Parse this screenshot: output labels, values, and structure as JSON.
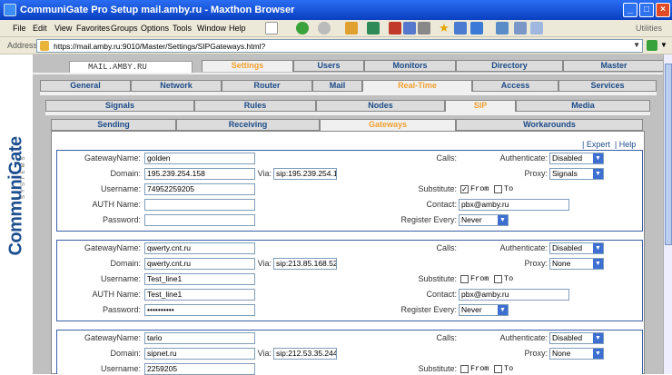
{
  "window": {
    "title": "CommuniGate Pro Setup mail.amby.ru - Maxthon Browser"
  },
  "menu": [
    "File",
    "Edit",
    "View",
    "Favorites",
    "Groups",
    "Options",
    "Tools",
    "Window",
    "Help"
  ],
  "utilities_label": "Utilities",
  "address": {
    "label": "Address",
    "url": "https://mail.amby.ru:9010/Master/Settings/SIPGateways.html?"
  },
  "logo": {
    "name": "CommuniGate",
    "sub": "SYSTEMS"
  },
  "server_name": "MAIL.AMBY.RU",
  "tabs_top": [
    {
      "label": "Settings",
      "selected": true
    },
    {
      "label": "Users",
      "selected": false
    },
    {
      "label": "Monitors",
      "selected": false
    },
    {
      "label": "Directory",
      "selected": false
    },
    {
      "label": "Master",
      "selected": false
    }
  ],
  "tabs_settings": [
    {
      "label": "General",
      "selected": false
    },
    {
      "label": "Network",
      "selected": false
    },
    {
      "label": "Router",
      "selected": false
    },
    {
      "label": "Mail",
      "selected": false
    },
    {
      "label": "Real-Time",
      "selected": true
    },
    {
      "label": "Access",
      "selected": false
    },
    {
      "label": "Services",
      "selected": false
    }
  ],
  "tabs_realtime": [
    {
      "label": "Signals",
      "selected": false
    },
    {
      "label": "Rules",
      "selected": false
    },
    {
      "label": "Nodes",
      "selected": false
    },
    {
      "label": "SIP",
      "selected": true
    },
    {
      "label": "Media",
      "selected": false
    }
  ],
  "tabs_sip": [
    {
      "label": "Sending",
      "selected": false
    },
    {
      "label": "Receiving",
      "selected": false
    },
    {
      "label": "Gateways",
      "selected": true
    },
    {
      "label": "Workarounds",
      "selected": false
    }
  ],
  "links": {
    "expert": "Expert",
    "help": "Help"
  },
  "labels": {
    "gateway_name": "GatewayName:",
    "domain": "Domain:",
    "username": "Username:",
    "auth_name": "AUTH Name:",
    "password": "Password:",
    "via": "Via:",
    "calls": "Calls:",
    "authenticate": "Authenticate:",
    "proxy": "Proxy:",
    "substitute": "Substitute:",
    "from": "From",
    "to": "To",
    "contact": "Contact:",
    "register_every": "Register Every:"
  },
  "gateways": [
    {
      "name": "golden",
      "domain": "195.239.254.158",
      "via": "sip:195.239.254.1",
      "username": "74952259205",
      "auth_name": "",
      "password": "",
      "authenticate": "Disabled",
      "proxy": "Signals",
      "sub_from": true,
      "sub_to": false,
      "contact": "pbx@amby.ru",
      "register_every": "Never"
    },
    {
      "name": "qwerty.cnt.ru",
      "domain": "qwerty.cnt.ru",
      "via": "sip:213.85.168.52",
      "username": "Test_line1",
      "auth_name": "Test_line1",
      "password": "••••••••••",
      "authenticate": "Disabled",
      "proxy": "None",
      "sub_from": false,
      "sub_to": false,
      "contact": "pbx@amby.ru",
      "register_every": "Never"
    },
    {
      "name": "tario",
      "domain": "sipnet.ru",
      "via": "sip:212.53.35.244",
      "username": "2259205",
      "authenticate": "Disabled",
      "proxy": "None",
      "sub_from": false,
      "sub_to": false
    }
  ]
}
